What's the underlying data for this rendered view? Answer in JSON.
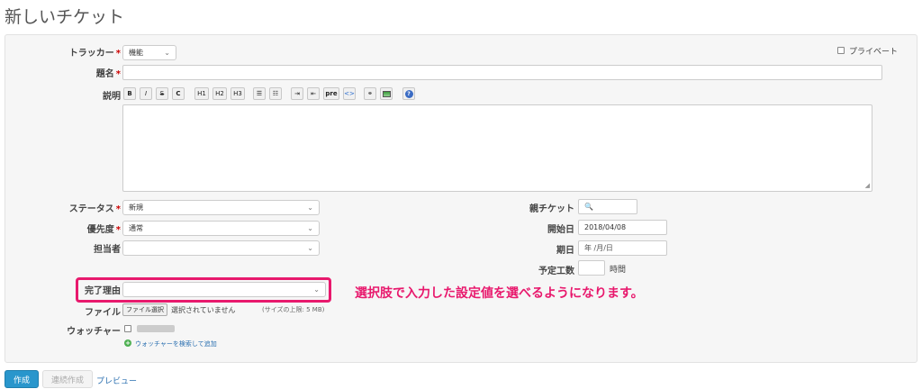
{
  "page": {
    "title": "新しいチケット"
  },
  "form": {
    "tracker": {
      "label": "トラッカー",
      "value": "機能"
    },
    "private": {
      "label": "プライベート"
    },
    "subject": {
      "label": "題名"
    },
    "description": {
      "label": "説明"
    },
    "status": {
      "label": "ステータス",
      "value": "新規"
    },
    "priority": {
      "label": "優先度",
      "value": "通常"
    },
    "assignee": {
      "label": "担当者",
      "value": ""
    },
    "completion_reason": {
      "label": "完了理由",
      "value": ""
    },
    "file": {
      "label": "ファイル",
      "button": "ファイル選択",
      "status": "選択されていません",
      "limit": "(サイズの上限: 5 MB)"
    },
    "watcher": {
      "label": "ウォッチャー",
      "search_link": "ウォッチャーを検索して追加"
    },
    "parent": {
      "label": "親チケット"
    },
    "start_date": {
      "label": "開始日",
      "value": "2018/04/08"
    },
    "due_date": {
      "label": "期日",
      "value": "年 /月/日"
    },
    "estimated": {
      "label": "予定工数",
      "unit": "時間"
    }
  },
  "toolbar": [
    "B",
    "I",
    "S",
    "C",
    "H1",
    "H2",
    "H3",
    "ul",
    "ol",
    "ind",
    "out",
    "pre",
    "<>",
    "link",
    "img",
    "help"
  ],
  "annotation": {
    "text": "選択肢で入力した設定値を選べるようになります。",
    "color": "#e8196d"
  },
  "buttons": {
    "create": "作成",
    "create_continue": "連続作成",
    "preview": "プレビュー"
  }
}
